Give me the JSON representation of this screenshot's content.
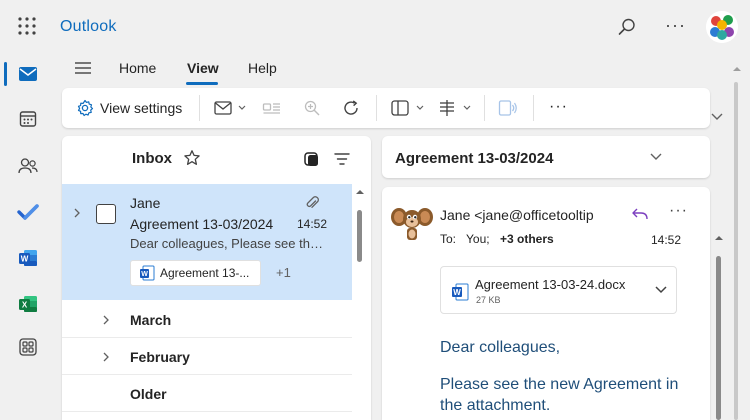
{
  "app": {
    "title": "Outlook"
  },
  "colors": {
    "brand": "#0f6cbd",
    "selection": "#cfe4fa",
    "body_text": "#1f4e79"
  },
  "ribbon": {
    "tabs": [
      {
        "label": "Home"
      },
      {
        "label": "View",
        "selected": true
      },
      {
        "label": "Help"
      }
    ],
    "view_settings_label": "View settings"
  },
  "list": {
    "folder_title": "Inbox",
    "selected_message": {
      "sender": "Jane",
      "subject": "Agreement 13-03/2024",
      "time": "14:52",
      "preview": "Dear colleagues, Please see the new Agreement in the attachment.",
      "attachment_chip": "Agreement 13-...",
      "more_attachments": "+1"
    },
    "groups": [
      {
        "label": "March"
      },
      {
        "label": "February"
      },
      {
        "label": "Older"
      }
    ]
  },
  "reading": {
    "subject": "Agreement 13-03/2024",
    "from": "Jane <jane@officetooltip",
    "to_label": "To:",
    "to_you": "You;",
    "to_others": "+3 others",
    "time": "14:52",
    "attachment": {
      "name": "Agreement 13-03-24.docx",
      "size": "27 KB"
    },
    "body_greeting": "Dear colleagues,",
    "body_text": "Please see the new Agreement in the attachment."
  },
  "icons": [
    "app-launcher-icon",
    "search-icon",
    "more-icon",
    "mail-icon",
    "calendar-icon",
    "people-icon",
    "todo-icon",
    "word-icon",
    "excel-icon",
    "more-apps-icon",
    "settings-gear-icon",
    "star-icon",
    "filter-icon",
    "attachment-icon",
    "reply-icon"
  ]
}
